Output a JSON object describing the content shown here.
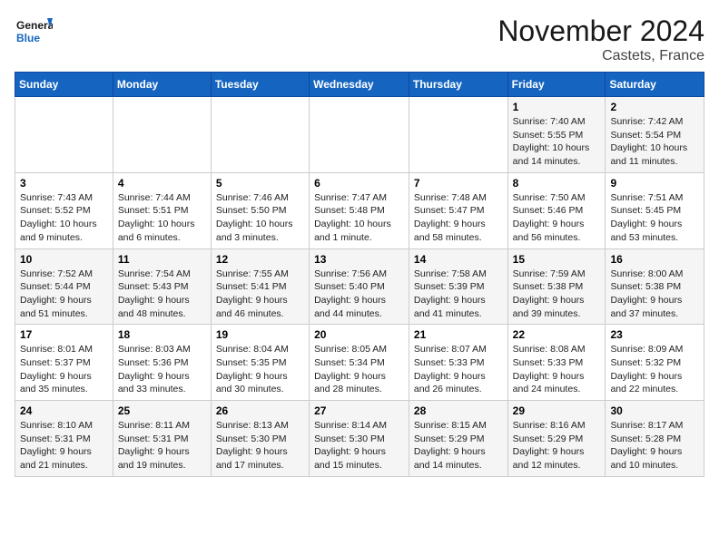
{
  "logo": {
    "line1": "General",
    "line2": "Blue"
  },
  "title": "November 2024",
  "location": "Castets, France",
  "weekdays": [
    "Sunday",
    "Monday",
    "Tuesday",
    "Wednesday",
    "Thursday",
    "Friday",
    "Saturday"
  ],
  "weeks": [
    [
      {
        "day": "",
        "info": ""
      },
      {
        "day": "",
        "info": ""
      },
      {
        "day": "",
        "info": ""
      },
      {
        "day": "",
        "info": ""
      },
      {
        "day": "",
        "info": ""
      },
      {
        "day": "1",
        "info": "Sunrise: 7:40 AM\nSunset: 5:55 PM\nDaylight: 10 hours and 14 minutes."
      },
      {
        "day": "2",
        "info": "Sunrise: 7:42 AM\nSunset: 5:54 PM\nDaylight: 10 hours and 11 minutes."
      }
    ],
    [
      {
        "day": "3",
        "info": "Sunrise: 7:43 AM\nSunset: 5:52 PM\nDaylight: 10 hours and 9 minutes."
      },
      {
        "day": "4",
        "info": "Sunrise: 7:44 AM\nSunset: 5:51 PM\nDaylight: 10 hours and 6 minutes."
      },
      {
        "day": "5",
        "info": "Sunrise: 7:46 AM\nSunset: 5:50 PM\nDaylight: 10 hours and 3 minutes."
      },
      {
        "day": "6",
        "info": "Sunrise: 7:47 AM\nSunset: 5:48 PM\nDaylight: 10 hours and 1 minute."
      },
      {
        "day": "7",
        "info": "Sunrise: 7:48 AM\nSunset: 5:47 PM\nDaylight: 9 hours and 58 minutes."
      },
      {
        "day": "8",
        "info": "Sunrise: 7:50 AM\nSunset: 5:46 PM\nDaylight: 9 hours and 56 minutes."
      },
      {
        "day": "9",
        "info": "Sunrise: 7:51 AM\nSunset: 5:45 PM\nDaylight: 9 hours and 53 minutes."
      }
    ],
    [
      {
        "day": "10",
        "info": "Sunrise: 7:52 AM\nSunset: 5:44 PM\nDaylight: 9 hours and 51 minutes."
      },
      {
        "day": "11",
        "info": "Sunrise: 7:54 AM\nSunset: 5:43 PM\nDaylight: 9 hours and 48 minutes."
      },
      {
        "day": "12",
        "info": "Sunrise: 7:55 AM\nSunset: 5:41 PM\nDaylight: 9 hours and 46 minutes."
      },
      {
        "day": "13",
        "info": "Sunrise: 7:56 AM\nSunset: 5:40 PM\nDaylight: 9 hours and 44 minutes."
      },
      {
        "day": "14",
        "info": "Sunrise: 7:58 AM\nSunset: 5:39 PM\nDaylight: 9 hours and 41 minutes."
      },
      {
        "day": "15",
        "info": "Sunrise: 7:59 AM\nSunset: 5:38 PM\nDaylight: 9 hours and 39 minutes."
      },
      {
        "day": "16",
        "info": "Sunrise: 8:00 AM\nSunset: 5:38 PM\nDaylight: 9 hours and 37 minutes."
      }
    ],
    [
      {
        "day": "17",
        "info": "Sunrise: 8:01 AM\nSunset: 5:37 PM\nDaylight: 9 hours and 35 minutes."
      },
      {
        "day": "18",
        "info": "Sunrise: 8:03 AM\nSunset: 5:36 PM\nDaylight: 9 hours and 33 minutes."
      },
      {
        "day": "19",
        "info": "Sunrise: 8:04 AM\nSunset: 5:35 PM\nDaylight: 9 hours and 30 minutes."
      },
      {
        "day": "20",
        "info": "Sunrise: 8:05 AM\nSunset: 5:34 PM\nDaylight: 9 hours and 28 minutes."
      },
      {
        "day": "21",
        "info": "Sunrise: 8:07 AM\nSunset: 5:33 PM\nDaylight: 9 hours and 26 minutes."
      },
      {
        "day": "22",
        "info": "Sunrise: 8:08 AM\nSunset: 5:33 PM\nDaylight: 9 hours and 24 minutes."
      },
      {
        "day": "23",
        "info": "Sunrise: 8:09 AM\nSunset: 5:32 PM\nDaylight: 9 hours and 22 minutes."
      }
    ],
    [
      {
        "day": "24",
        "info": "Sunrise: 8:10 AM\nSunset: 5:31 PM\nDaylight: 9 hours and 21 minutes."
      },
      {
        "day": "25",
        "info": "Sunrise: 8:11 AM\nSunset: 5:31 PM\nDaylight: 9 hours and 19 minutes."
      },
      {
        "day": "26",
        "info": "Sunrise: 8:13 AM\nSunset: 5:30 PM\nDaylight: 9 hours and 17 minutes."
      },
      {
        "day": "27",
        "info": "Sunrise: 8:14 AM\nSunset: 5:30 PM\nDaylight: 9 hours and 15 minutes."
      },
      {
        "day": "28",
        "info": "Sunrise: 8:15 AM\nSunset: 5:29 PM\nDaylight: 9 hours and 14 minutes."
      },
      {
        "day": "29",
        "info": "Sunrise: 8:16 AM\nSunset: 5:29 PM\nDaylight: 9 hours and 12 minutes."
      },
      {
        "day": "30",
        "info": "Sunrise: 8:17 AM\nSunset: 5:28 PM\nDaylight: 9 hours and 10 minutes."
      }
    ]
  ]
}
